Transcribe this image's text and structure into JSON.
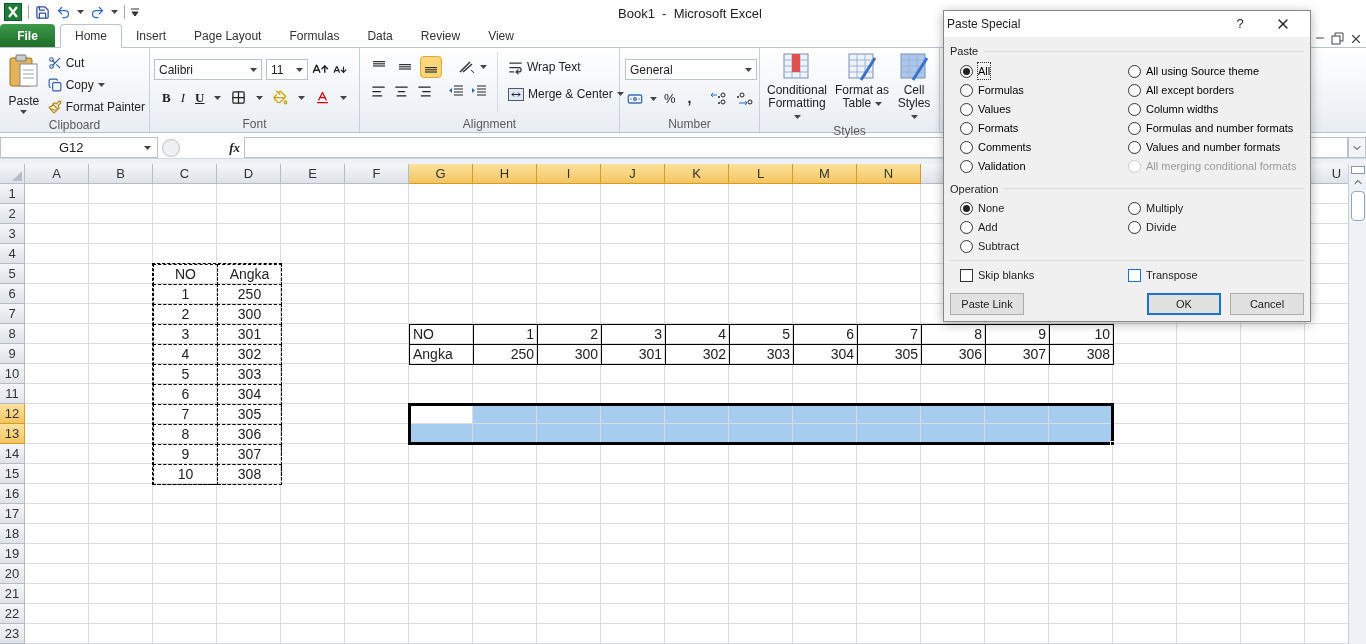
{
  "window": {
    "title": "Book1  -  Microsoft Excel"
  },
  "tabs": [
    {
      "label": "File",
      "kind": "file",
      "selected": false
    },
    {
      "label": "Home",
      "kind": "tab",
      "selected": true
    },
    {
      "label": "Insert",
      "kind": "tab",
      "selected": false
    },
    {
      "label": "Page Layout",
      "kind": "tab",
      "selected": false
    },
    {
      "label": "Formulas",
      "kind": "tab",
      "selected": false
    },
    {
      "label": "Data",
      "kind": "tab",
      "selected": false
    },
    {
      "label": "Review",
      "kind": "tab",
      "selected": false
    },
    {
      "label": "View",
      "kind": "tab",
      "selected": false
    }
  ],
  "ribbon": {
    "clipboard": {
      "label": "Clipboard",
      "paste": "Paste",
      "cut": "Cut",
      "copy": "Copy",
      "format_painter": "Format Painter"
    },
    "font": {
      "label": "Font",
      "name": "Calibri",
      "size": "11",
      "bold": "B",
      "italic": "I",
      "underline": "U"
    },
    "alignment": {
      "label": "Alignment",
      "vertical": [
        {
          "selected": false
        },
        {
          "selected": false
        },
        {
          "selected": true
        }
      ],
      "wrap_text": "Wrap Text",
      "merge": "Merge & Center"
    },
    "number": {
      "label": "Number",
      "format": "General",
      "percent": "%",
      "comma": ","
    },
    "styles": {
      "label": "Styles",
      "buttons": [
        "Conditional Formatting",
        "Format as Table",
        "Cell Styles"
      ]
    }
  },
  "formula_bar": {
    "name_box": "G12",
    "function_label": "fx"
  },
  "column_headers": [
    {
      "label": "A",
      "selected": false
    },
    {
      "label": "B",
      "selected": false
    },
    {
      "label": "C",
      "selected": false
    },
    {
      "label": "D",
      "selected": false
    },
    {
      "label": "E",
      "selected": false
    },
    {
      "label": "F",
      "selected": false
    },
    {
      "label": "G",
      "selected": true
    },
    {
      "label": "H",
      "selected": true
    },
    {
      "label": "I",
      "selected": true
    },
    {
      "label": "J",
      "selected": true
    },
    {
      "label": "K",
      "selected": true
    },
    {
      "label": "L",
      "selected": true
    },
    {
      "label": "M",
      "selected": true
    },
    {
      "label": "N",
      "selected": true
    },
    {
      "label": "U",
      "selected": false
    }
  ],
  "row_headers": [
    {
      "label": "1",
      "selected": false
    },
    {
      "label": "2",
      "selected": false
    },
    {
      "label": "3",
      "selected": false
    },
    {
      "label": "4",
      "selected": false
    },
    {
      "label": "5",
      "selected": false
    },
    {
      "label": "6",
      "selected": false
    },
    {
      "label": "7",
      "selected": false
    },
    {
      "label": "8",
      "selected": false
    },
    {
      "label": "9",
      "selected": false
    },
    {
      "label": "10",
      "selected": false
    },
    {
      "label": "11",
      "selected": false
    },
    {
      "label": "12",
      "selected": true
    },
    {
      "label": "13",
      "selected": true
    },
    {
      "label": "14",
      "selected": false
    },
    {
      "label": "15",
      "selected": false
    },
    {
      "label": "16",
      "selected": false
    },
    {
      "label": "17",
      "selected": false
    },
    {
      "label": "18",
      "selected": false
    },
    {
      "label": "19",
      "selected": false
    },
    {
      "label": "20",
      "selected": false
    },
    {
      "label": "21",
      "selected": false
    },
    {
      "label": "22",
      "selected": false
    },
    {
      "label": "23",
      "selected": false
    }
  ],
  "source_table": {
    "copied": true,
    "rows": [
      [
        "NO",
        "Angka"
      ],
      [
        "1",
        "250"
      ],
      [
        "2",
        "300"
      ],
      [
        "3",
        "301"
      ],
      [
        "4",
        "302"
      ],
      [
        "5",
        "303"
      ],
      [
        "6",
        "304"
      ],
      [
        "7",
        "305"
      ],
      [
        "8",
        "306"
      ],
      [
        "9",
        "307"
      ],
      [
        "10",
        "308"
      ]
    ]
  },
  "transposed_table": {
    "rows": [
      [
        "NO",
        "1",
        "2",
        "3",
        "4",
        "5",
        "6",
        "7",
        "8",
        "9",
        "10"
      ],
      [
        "Angka",
        "250",
        "300",
        "301",
        "302",
        "303",
        "304",
        "305",
        "306",
        "307",
        "308"
      ]
    ]
  },
  "paste_dialog": {
    "title": "Paste Special",
    "help": "?",
    "paste_label": "Paste",
    "paste_options": [
      {
        "label": "All",
        "selected": true,
        "disabled": false
      },
      {
        "label": "All using Source theme",
        "selected": false,
        "disabled": false
      },
      {
        "label": "Formulas",
        "selected": false,
        "disabled": false
      },
      {
        "label": "All except borders",
        "selected": false,
        "disabled": false
      },
      {
        "label": "Values",
        "selected": false,
        "disabled": false
      },
      {
        "label": "Column widths",
        "selected": false,
        "disabled": false
      },
      {
        "label": "Formats",
        "selected": false,
        "disabled": false
      },
      {
        "label": "Formulas and number formats",
        "selected": false,
        "disabled": false
      },
      {
        "label": "Comments",
        "selected": false,
        "disabled": false
      },
      {
        "label": "Values and number formats",
        "selected": false,
        "disabled": false
      },
      {
        "label": "Validation",
        "selected": false,
        "disabled": false
      },
      {
        "label": "All merging conditional formats",
        "selected": false,
        "disabled": true
      }
    ],
    "operation_label": "Operation",
    "operations": [
      {
        "label": "None",
        "selected": true
      },
      {
        "label": "Multiply",
        "selected": false
      },
      {
        "label": "Add",
        "selected": false
      },
      {
        "label": "Divide",
        "selected": false
      },
      {
        "label": "Subtract",
        "selected": false
      }
    ],
    "checks": [
      {
        "label": "Skip blanks",
        "checked": false
      },
      {
        "label": "Transpose",
        "checked": false
      }
    ],
    "buttons": [
      {
        "label": "Paste Link",
        "kind": "normal"
      },
      {
        "label": "OK",
        "kind": "default"
      },
      {
        "label": "Cancel",
        "kind": "normal"
      }
    ]
  }
}
